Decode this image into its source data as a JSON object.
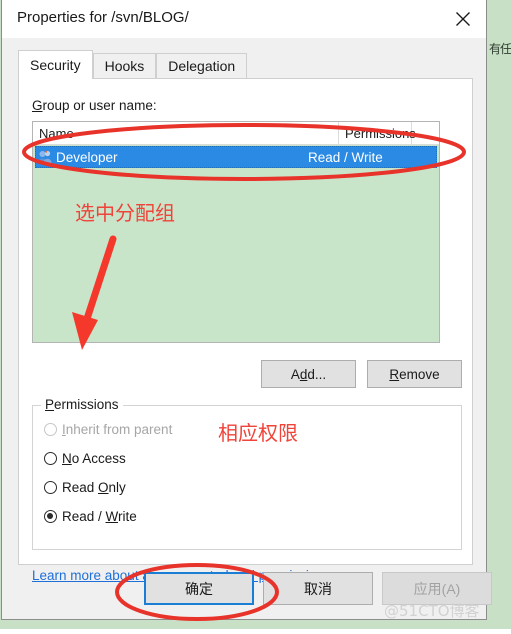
{
  "backdrop": {
    "color": "#c7e0c6",
    "clipped_text": "有任"
  },
  "window": {
    "title": "Properties for /svn/BLOG/",
    "close_icon": "close-icon"
  },
  "tabs": [
    {
      "label": "Security",
      "active": true
    },
    {
      "label": "Hooks",
      "active": false
    },
    {
      "label": "Delegation",
      "active": false
    }
  ],
  "security_tab": {
    "group_label_prefix": "G",
    "group_label_rest": "roup or user name:",
    "list": {
      "columns": [
        "Name",
        "Permissions",
        ""
      ],
      "rows": [
        {
          "icon": "group-users-icon",
          "name": "Developer",
          "permissions": "Read / Write",
          "selected": true
        }
      ],
      "background_color": "#c9e5c9",
      "selection_color": "#2a8ae4"
    },
    "add_button": {
      "accel": "d",
      "before": "A",
      "after": "d..."
    },
    "remove_button": {
      "accel": "R",
      "before": "",
      "after": "emove"
    },
    "permissions_group": {
      "legend_accel": "P",
      "legend_rest": "ermissions",
      "options": [
        {
          "before": "",
          "accel": "I",
          "after": "nherit from parent",
          "selected": false,
          "disabled": true
        },
        {
          "before": "",
          "accel": "N",
          "after": "o Access",
          "selected": false,
          "disabled": false
        },
        {
          "before": "Read ",
          "accel": "O",
          "after": "nly",
          "selected": false,
          "disabled": false
        },
        {
          "before": "Read / ",
          "accel": "W",
          "after": "rite",
          "selected": true,
          "disabled": false
        }
      ]
    },
    "help_link": "Learn more about access control and permissions"
  },
  "buttons": {
    "ok": "确定",
    "cancel": "取消",
    "apply": "应用(A)"
  },
  "watermark": "@51CTO博客",
  "annotations": {
    "color": "#f0433a",
    "text_1": "选中分配组",
    "text_2": "相应权限",
    "ellipse_selected_row": "red-ellipse-around-selected-row",
    "ellipse_ok_button": "red-ellipse-around-ok-button",
    "arrow": "red-arrow-pointing-to-permissions"
  }
}
